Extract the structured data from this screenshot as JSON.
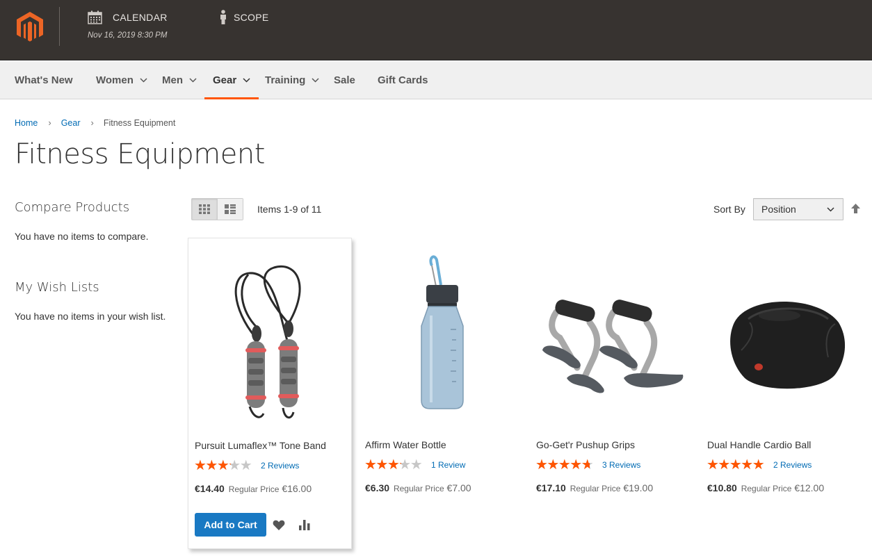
{
  "admin_bar": {
    "calendar_label": "CALENDAR",
    "calendar_date": "Nov 16, 2019 8:30 PM",
    "scope_label": "SCOPE",
    "icons": [
      "magento-logo",
      "calendar-icon",
      "person-icon"
    ]
  },
  "nav": {
    "items": [
      {
        "label": "What's New",
        "has_dropdown": false
      },
      {
        "label": "Women",
        "has_dropdown": true
      },
      {
        "label": "Men",
        "has_dropdown": true
      },
      {
        "label": "Gear",
        "has_dropdown": true,
        "active": true
      },
      {
        "label": "Training",
        "has_dropdown": true
      },
      {
        "label": "Sale",
        "has_dropdown": false
      },
      {
        "label": "Gift Cards",
        "has_dropdown": false
      }
    ]
  },
  "breadcrumbs": [
    {
      "label": "Home",
      "link": true
    },
    {
      "label": "Gear",
      "link": true
    },
    {
      "label": "Fitness Equipment",
      "link": false
    }
  ],
  "page_title": "Fitness Equipment",
  "sidebar": {
    "compare_title": "Compare Products",
    "compare_empty": "You have no items to compare.",
    "wishlist_title": "My Wish Lists",
    "wishlist_empty": "You have no items in your wish list."
  },
  "toolbar": {
    "view_modes": [
      "grid",
      "list"
    ],
    "active_mode": "grid",
    "amount": "Items 1-9 of 11",
    "sort_label": "Sort By",
    "sort_value": "Position"
  },
  "products": [
    {
      "name": "Pursuit Lumaflex™ Tone Band",
      "rating": 3,
      "reviews": "2 Reviews",
      "final_price": "€14.40",
      "regular_label": "Regular Price",
      "regular_price": "€16.00",
      "add_to_cart": "Add to Cart",
      "hovered": true
    },
    {
      "name": "Affirm Water Bottle",
      "rating": 3,
      "reviews": "1 Review",
      "final_price": "€6.30",
      "regular_label": "Regular Price",
      "regular_price": "€7.00"
    },
    {
      "name": "Go-Get'r Pushup Grips",
      "rating": 4.5,
      "reviews": "3 Reviews",
      "final_price": "€17.10",
      "regular_label": "Regular Price",
      "regular_price": "€19.00"
    },
    {
      "name": "Dual Handle Cardio Ball",
      "rating": 5,
      "reviews": "2 Reviews",
      "final_price": "€10.80",
      "regular_label": "Regular Price",
      "regular_price": "€12.00"
    }
  ],
  "colors": {
    "admin_bar": "#373330",
    "accent": "#ff5501",
    "link": "#006bb4",
    "button": "#1979c3"
  }
}
